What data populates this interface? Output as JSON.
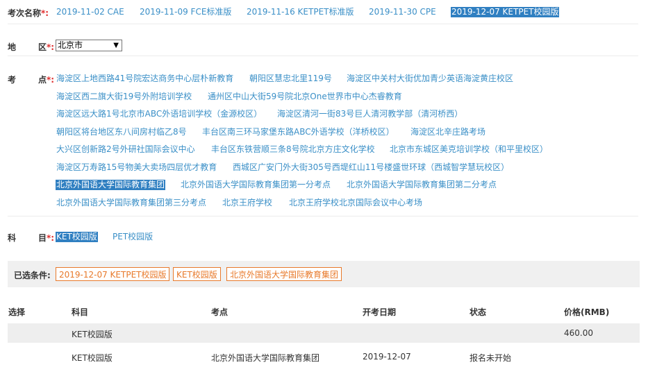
{
  "exam_session": {
    "label": "考次名称",
    "required_mark": "*:",
    "options": [
      "2019-11-02 CAE",
      "2019-11-09 FCE标准版",
      "2019-11-16 KETPET标准版",
      "2019-11-30 CPE",
      "2019-12-07 KETPET校园版"
    ],
    "selected_index": 4
  },
  "region": {
    "label_a": "地",
    "label_b": "区",
    "required_mark": "*:",
    "selected": "北京市"
  },
  "venue": {
    "label_a": "考",
    "label_b": "点",
    "required_mark": "*:",
    "rows": [
      [
        "海淀区上地西路41号院宏达商务中心层朴新教育",
        "朝阳区慧忠北里119号",
        "海淀区中关村大街优加青少英语海淀黄庄校区"
      ],
      [
        "海淀区西二旗大街19号外附培训学校",
        "通州区中山大街59号院北京One世界市中心杰睿教育"
      ],
      [
        "海淀区远大路1号北京市ABC外语培训学校（金源校区）",
        "海淀区清河一街83号巨人清河教学部（清河桥西）"
      ],
      [
        "朝阳区将台地区东八间房村临乙8号",
        "丰台区南三环马家堡东路ABC外语学校（洋桥校区）",
        "海淀区北辛庄路考场"
      ],
      [
        "大兴区创新路2号外研社国际会议中心",
        "丰台区东铁营顺三条8号院北京方庄文化学校",
        "北京市东城区美克培训学校（和平里校区）"
      ],
      [
        "海淀区万寿路15号物美大卖场四层优才教育",
        "西城区广安门外大街305号西堤红山11号楼盛世环球（西城智学慧玩校区）"
      ],
      [
        "北京外国语大学国际教育集团",
        "北京外国语大学国际教育集团第一分考点",
        "北京外国语大学国际教育集团第二分考点"
      ],
      [
        "北京外国语大学国际教育集团第三分考点",
        "北京王府学校",
        "北京王府学校北京国际会议中心考场"
      ]
    ],
    "selected": "北京外国语大学国际教育集团"
  },
  "subject": {
    "label_a": "科",
    "label_b": "目",
    "required_mark": "*:",
    "options": [
      "KET校园版",
      "PET校园版"
    ],
    "selected_index": 0
  },
  "conditions": {
    "label": "已选条件:",
    "chips": [
      "2019-12-07 KETPET校园版",
      "KET校园版",
      "北京外国语大学国际教育集团"
    ]
  },
  "table": {
    "headers": [
      "选择",
      "科目",
      "考点",
      "开考日期",
      "状态",
      "价格(RMB)"
    ],
    "rows": [
      [
        "",
        "KET校园版",
        "",
        "",
        "",
        "460.00"
      ],
      [
        "",
        "KET校园版",
        "北京外国语大学国际教育集团",
        "2019-12-07",
        "报名未开始",
        ""
      ]
    ]
  }
}
